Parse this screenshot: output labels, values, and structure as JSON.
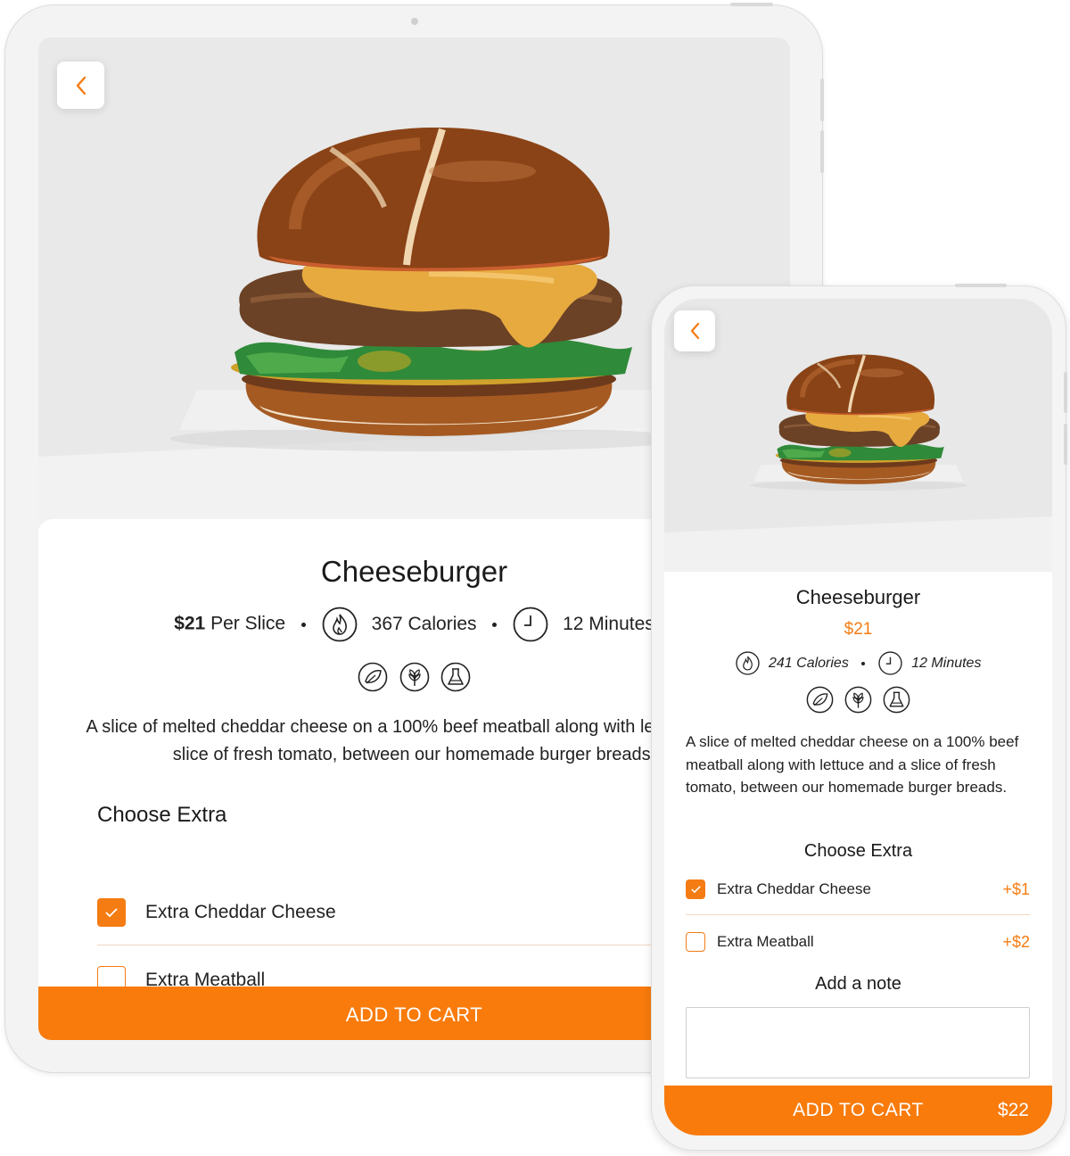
{
  "tablet": {
    "product": {
      "name": "Cheeseburger",
      "price": "$21",
      "price_unit": "Per Slice",
      "calories": "367 Calories",
      "time": "12 Minutes",
      "description": "A slice of melted cheddar cheese on a 100% beef meatball along with lettuce and a slice of fresh tomato, between our homemade burger breads."
    },
    "extras_title": "Choose Extra",
    "extras": [
      {
        "label": "Extra Cheddar Cheese",
        "checked": true
      },
      {
        "label": "Extra Meatball",
        "checked": false
      }
    ],
    "cart_label": "ADD TO CART"
  },
  "phone": {
    "product": {
      "name": "Cheeseburger",
      "price": "$21",
      "calories": "241 Calories",
      "time": "12 Minutes",
      "description": "A slice of melted cheddar cheese on a 100% beef meatball along with lettuce and a slice of fresh tomato, between our homemade burger breads."
    },
    "extras_title": "Choose Extra",
    "extras": [
      {
        "label": "Extra Cheddar Cheese",
        "price": "+$1",
        "checked": true
      },
      {
        "label": "Extra Meatball",
        "price": "+$2",
        "checked": false
      }
    ],
    "note_label": "Add a note",
    "note_value": "",
    "cart_label": "ADD TO CART",
    "cart_total": "$22"
  },
  "icons": {
    "back": "chevron-left-icon",
    "calories": "flame-icon",
    "time": "clock-icon",
    "diet": [
      "vegetarian-leaf-icon",
      "gluten-wheat-icon",
      "lab-flask-icon"
    ]
  },
  "colors": {
    "accent": "#f47c13",
    "cart_button": "#f87b0c",
    "divider": "#f3d5bd",
    "device_frame": "#f3f3f3"
  }
}
